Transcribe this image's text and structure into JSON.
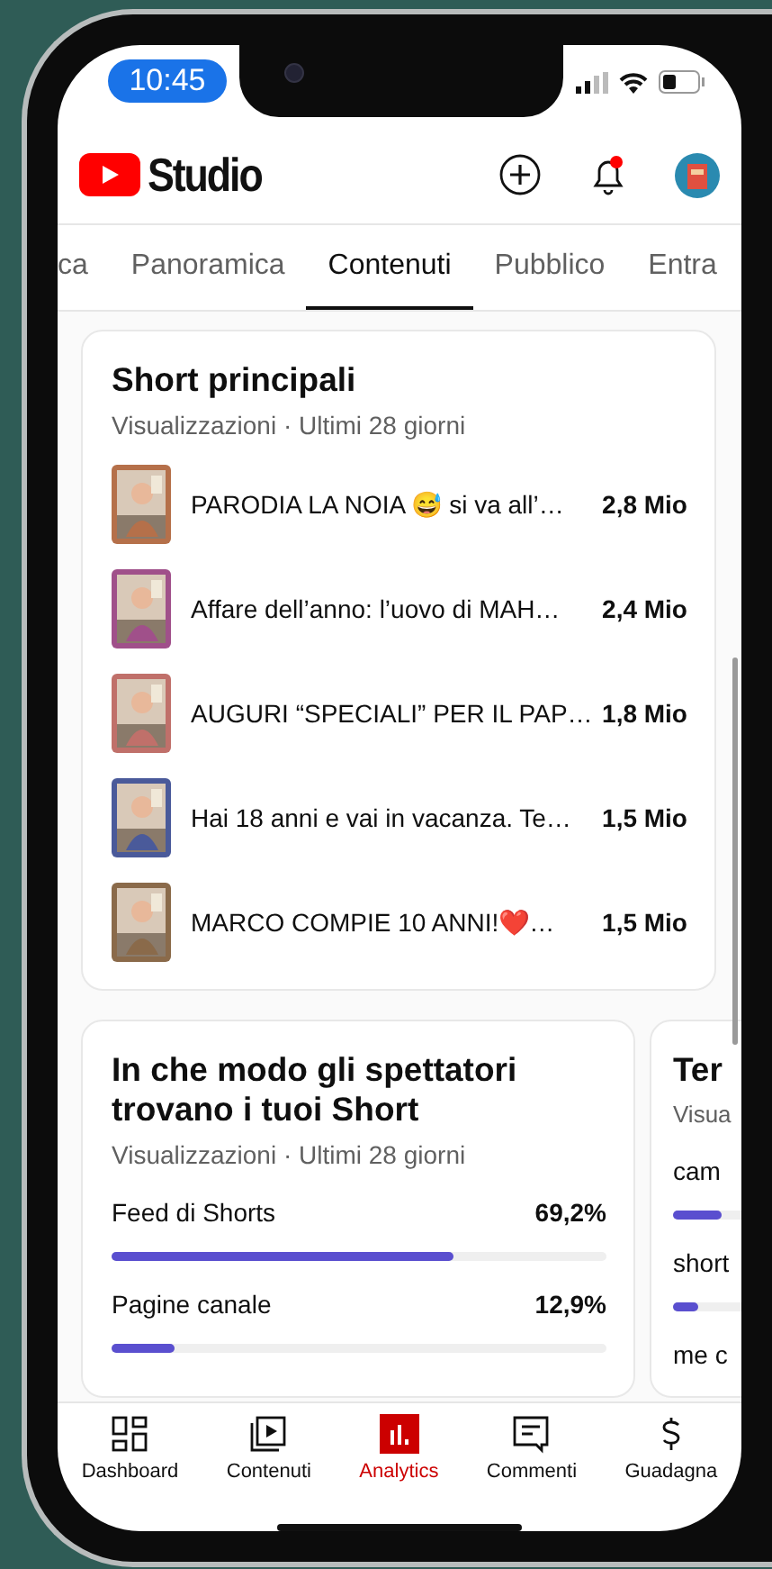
{
  "status_bar": {
    "time": "10:45"
  },
  "header": {
    "title": "Studio"
  },
  "tabs": [
    {
      "label": "ca",
      "selected": false
    },
    {
      "label": "Panoramica",
      "selected": false
    },
    {
      "label": "Contenuti",
      "selected": true
    },
    {
      "label": "Pubblico",
      "selected": false
    },
    {
      "label": "Entra",
      "selected": false
    }
  ],
  "top_shorts": {
    "title": "Short principali",
    "subtitle": "Visualizzazioni · Ultimi 28 giorni",
    "rows": [
      {
        "title": "PARODIA LA NOIA 😅 si va all’…",
        "views": "2,8 Mio"
      },
      {
        "title": "Affare dell’anno: l’uovo di MAH…",
        "views": "2,4 Mio"
      },
      {
        "title": "AUGURI “SPECIALI” PER IL PAP…",
        "views": "1,8 Mio"
      },
      {
        "title": "Hai 18 anni e vai in vacanza. Te…",
        "views": "1,5 Mio"
      },
      {
        "title": "MARCO COMPIE 10 ANNI!❤️…",
        "views": "1,5 Mio"
      }
    ]
  },
  "traffic_card": {
    "title": "In che modo gli spettatori trovano i tuoi Short",
    "subtitle": "Visualizzazioni · Ultimi 28 giorni",
    "rows": [
      {
        "label": "Feed di Shorts",
        "value": "69,2%",
        "level": 0.692
      },
      {
        "label": "Pagine canale",
        "value": "12,9%",
        "level": 0.129
      }
    ]
  },
  "search_card": {
    "title": "Ter",
    "subtitle": "Visua",
    "rows": [
      {
        "label": "cam",
        "level": 0.1
      },
      {
        "label": "short",
        "level": 0.05
      },
      {
        "label": "me c"
      }
    ]
  },
  "bottom_nav": [
    {
      "label": "Dashboard",
      "selected": false
    },
    {
      "label": "Contenuti",
      "selected": false
    },
    {
      "label": "Analytics",
      "selected": true
    },
    {
      "label": "Commenti",
      "selected": false
    },
    {
      "label": "Guadagna",
      "selected": false
    }
  ]
}
